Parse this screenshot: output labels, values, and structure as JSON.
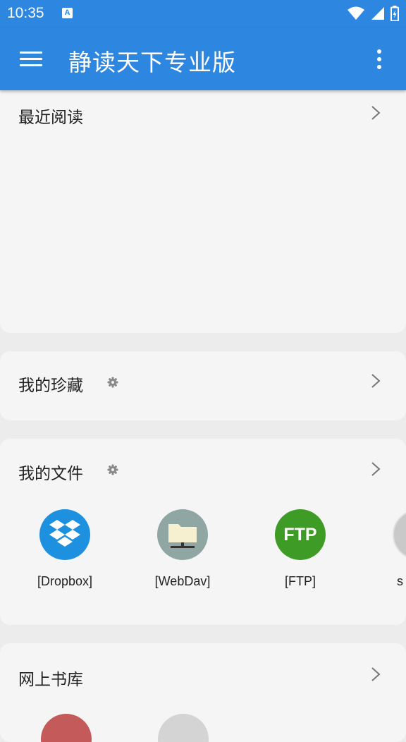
{
  "status_bar": {
    "time": "10:35",
    "notification_icon": "A"
  },
  "app_bar": {
    "title": "静读天下专业版"
  },
  "sections": {
    "recent": {
      "title": "最近阅读"
    },
    "favorites": {
      "title": "我的珍藏"
    },
    "my_files": {
      "title": "我的文件",
      "items": [
        {
          "label": "[Dropbox]",
          "icon": "dropbox-icon",
          "color": "#1e90e0"
        },
        {
          "label": "[WebDav]",
          "icon": "folder-network-icon",
          "color": "#8fa6a3"
        },
        {
          "label": "[FTP]",
          "icon": "ftp-icon",
          "color": "#3e9b26",
          "icon_text": "FTP"
        },
        {
          "label": "s",
          "icon": "storage-icon",
          "color": "#c9c9c9"
        }
      ]
    },
    "online_library": {
      "title": "网上书库"
    }
  },
  "colors": {
    "primary": "#2d86e0",
    "card_bg": "#f5f5f5",
    "page_bg": "#ececec"
  }
}
